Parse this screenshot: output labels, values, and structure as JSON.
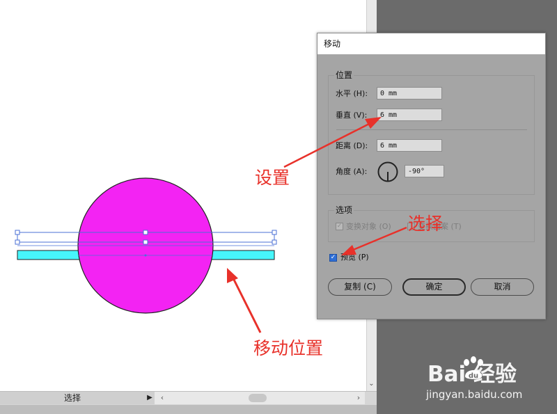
{
  "statusbar": {
    "tool_label": "选择",
    "menu_arrow": "▶",
    "scroll_left": "‹",
    "scroll_right": "›",
    "scroll_down": "⌄"
  },
  "artwork": {
    "circle_fill": "#f323f3",
    "bar_fill": "#47f6fb",
    "selection_color": "#4a6fd6"
  },
  "annotations": {
    "color": "#e8312a",
    "move_position": "移动位置",
    "settings": "设置",
    "select": "选择"
  },
  "dialog": {
    "title": "移动",
    "position_group": "位置",
    "horizontal_label": "水平 (H):",
    "horizontal_value": "0 mm",
    "vertical_label": "垂直 (V):",
    "vertical_value": "6 mm",
    "distance_label": "距离 (D):",
    "distance_value": "6 mm",
    "angle_label": "角度 (A):",
    "angle_value": "-90°",
    "options_group": "选项",
    "transform_objects_label": "变换对象 (O)",
    "transform_objects_checked": true,
    "transform_patterns_label": "变换图案 (T)",
    "transform_patterns_checked": false,
    "preview_label": "预览 (P)",
    "preview_checked": true,
    "copy_button": "复制 (C)",
    "ok_button": "确定",
    "cancel_button": "取消"
  },
  "watermark": {
    "logo_text": "Bai  经验",
    "url": "jingyan.baidu.com"
  }
}
